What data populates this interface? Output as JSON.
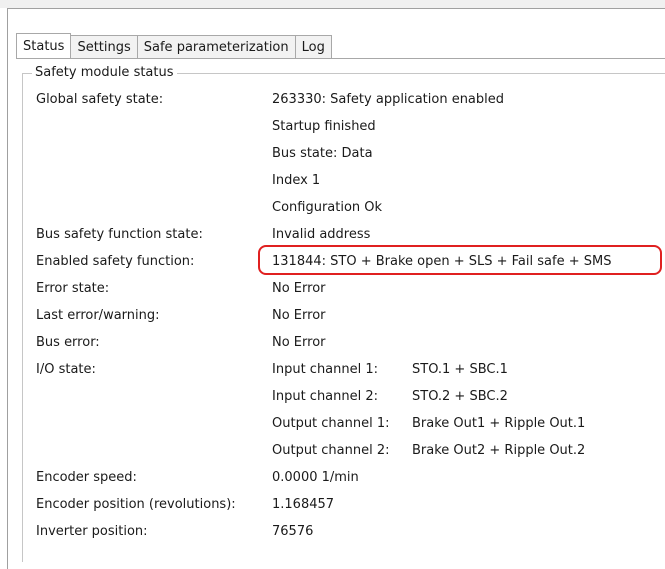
{
  "tabs": [
    {
      "label": "Status",
      "active": true
    },
    {
      "label": "Settings",
      "active": false
    },
    {
      "label": "Safe parameterization",
      "active": false
    },
    {
      "label": "Log",
      "active": false
    }
  ],
  "group_title": "Safety module status",
  "rows": {
    "global_state": {
      "label": "Global safety state:",
      "values": [
        "263330: Safety application enabled",
        "Startup finished",
        "Bus state: Data",
        "Index 1",
        "Configuration Ok"
      ]
    },
    "bus_function_state": {
      "label": "Bus safety function state:",
      "value": "Invalid address"
    },
    "enabled_function": {
      "label": "Enabled safety function:",
      "value": "131844: STO + Brake open + SLS + Fail safe + SMS"
    },
    "error_state": {
      "label": "Error state:",
      "value": "No Error"
    },
    "last_error": {
      "label": "Last error/warning:",
      "value": "No Error"
    },
    "bus_error": {
      "label": "Bus error:",
      "value": "No Error"
    },
    "io_state": {
      "label": "I/O state:",
      "channels": [
        {
          "name": "Input channel 1:",
          "value": "STO.1 + SBC.1"
        },
        {
          "name": "Input channel 2:",
          "value": "STO.2 + SBC.2"
        },
        {
          "name": "Output channel 1:",
          "value": "Brake Out1 + Ripple Out.1"
        },
        {
          "name": "Output channel 2:",
          "value": "Brake Out2 + Ripple Out.2"
        }
      ]
    },
    "encoder_speed": {
      "label": "Encoder speed:",
      "value": "0.0000 1/min"
    },
    "encoder_position": {
      "label": "Encoder position (revolutions):",
      "value": "1.168457"
    },
    "inverter_position": {
      "label": "Inverter position:",
      "value": "76576"
    }
  },
  "colors": {
    "highlight": "#e02020",
    "border": "#a8a8a8"
  }
}
